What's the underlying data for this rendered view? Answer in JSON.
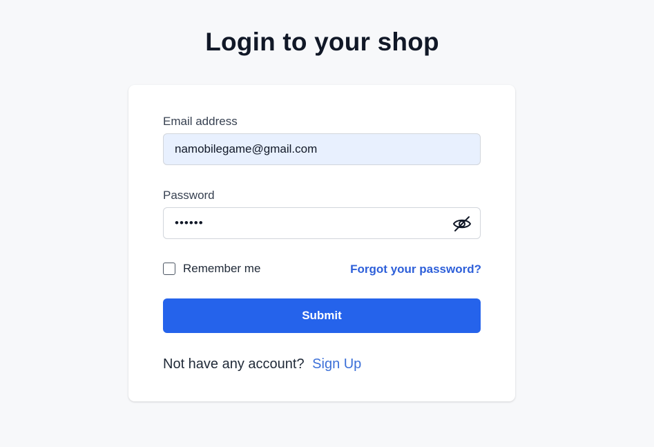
{
  "page": {
    "title": "Login to your shop"
  },
  "form": {
    "email_label": "Email address",
    "email_value": "namobilegame@gmail.com",
    "password_label": "Password",
    "password_value": "••••••",
    "remember_label": "Remember me",
    "remember_checked": false,
    "forgot_label": "Forgot your password?",
    "submit_label": "Submit"
  },
  "signup": {
    "prompt": "Not have any account?",
    "link_label": "Sign Up"
  },
  "icons": {
    "password_toggle": "eye-slash-icon"
  },
  "colors": {
    "accent": "#2563eb",
    "link": "#2d5fd9",
    "background": "#f7f8fa",
    "email_field_bg": "#e8f0fe"
  }
}
